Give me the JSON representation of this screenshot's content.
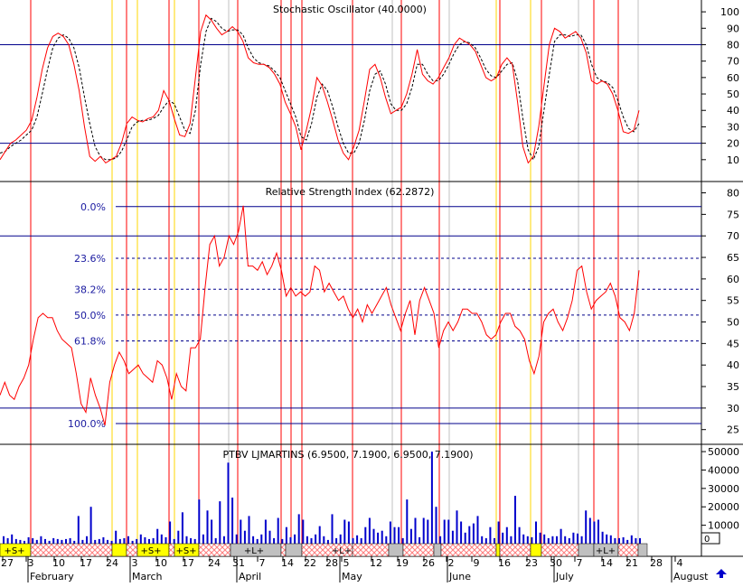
{
  "colors": {
    "background": "#ffffff",
    "kline": "#ff0000",
    "dline": "#000000",
    "level": "#00008b",
    "volume": "#0000cc",
    "vline_red": "#ff0000",
    "vline_yellow": "#ffd700",
    "vline_gray": "#c0c0c0",
    "fib_text": "#1a1aa0",
    "band_red": "#ff8080",
    "band_gray": "#c0c0c0",
    "band_yellow": "#ffff00",
    "arrow": "#0000cc"
  },
  "chart_data": [
    {
      "type": "line",
      "title": "Stochastic Oscillator (40.0000)",
      "ylim": [
        0,
        105
      ],
      "y_ticks": [
        10,
        20,
        30,
        40,
        50,
        60,
        70,
        80,
        90,
        100
      ],
      "levels": [
        80,
        20
      ],
      "x": [
        0,
        1,
        2,
        3,
        4,
        5,
        6,
        7,
        8,
        9,
        10,
        11,
        12,
        13,
        14,
        15,
        16,
        17,
        18,
        19,
        20,
        21,
        22,
        23,
        24,
        25,
        26,
        27,
        28,
        29,
        30,
        31,
        32,
        33,
        34,
        35,
        36,
        37,
        38,
        39,
        40,
        41,
        42,
        43,
        44,
        45,
        46,
        47,
        48,
        49,
        50,
        51,
        52,
        53,
        54,
        55,
        56,
        57,
        58,
        59,
        60,
        61,
        62,
        63,
        64,
        65,
        66,
        67,
        68,
        69,
        70,
        71,
        72,
        73,
        74,
        75,
        76,
        77,
        78,
        79,
        80,
        81,
        82,
        83,
        84,
        85,
        86,
        87,
        88,
        89,
        90,
        91,
        92,
        93,
        94,
        95,
        96,
        97,
        98,
        99,
        100,
        101,
        102,
        103,
        104,
        105,
        106,
        107,
        108,
        109,
        110,
        111,
        112,
        113,
        114,
        115,
        116,
        117,
        118,
        119,
        120,
        121,
        122,
        123,
        124,
        125,
        126,
        127,
        128,
        129,
        130,
        131,
        132,
        133,
        134,
        135,
        136,
        137,
        138,
        139,
        140,
        141,
        142,
        143,
        144,
        145,
        146,
        147,
        148,
        149,
        150,
        151,
        152,
        153,
        154,
        155,
        156,
        157,
        158,
        159,
        160,
        161,
        162,
        163,
        164,
        165,
        166,
        167,
        168,
        169,
        170,
        171,
        172,
        173,
        174,
        175,
        176,
        177,
        178,
        179,
        180,
        181
      ],
      "series": [
        {
          "values": [
            10,
            15,
            20,
            22,
            25,
            28,
            34,
            48,
            65,
            78,
            85,
            87,
            85,
            80,
            68,
            52,
            30,
            12,
            9,
            12,
            8,
            10,
            12,
            20,
            32,
            36,
            34,
            33,
            35,
            36,
            40,
            52,
            46,
            35,
            25,
            24,
            32,
            60,
            88,
            98,
            95,
            90,
            86,
            88,
            91,
            88,
            82,
            72,
            69,
            68,
            68,
            66,
            62,
            56,
            45,
            38,
            30,
            16,
            28,
            42,
            60,
            55,
            45,
            34,
            22,
            14,
            10,
            18,
            28,
            46,
            65,
            68,
            60,
            48,
            38,
            40,
            42,
            50,
            62,
            77,
            62,
            58,
            56,
            60,
            66,
            72,
            80,
            84,
            82,
            80,
            76,
            68,
            60,
            58,
            60,
            68,
            72,
            68,
            45,
            18,
            8,
            12,
            30,
            55,
            80,
            90,
            88,
            84,
            86,
            88,
            84,
            75,
            58,
            56,
            58,
            56,
            50,
            40,
            27,
            26,
            28,
            40
          ]
        },
        {
          "values": [
            14,
            15,
            18,
            20,
            22,
            25,
            28,
            36,
            50,
            65,
            78,
            84,
            86,
            84,
            78,
            66,
            48,
            32,
            18,
            12,
            10,
            10,
            11,
            15,
            22,
            30,
            33,
            34,
            34,
            35,
            37,
            42,
            46,
            44,
            36,
            28,
            26,
            40,
            68,
            88,
            96,
            94,
            90,
            88,
            89,
            89,
            86,
            78,
            72,
            69,
            68,
            67,
            64,
            60,
            52,
            44,
            36,
            24,
            22,
            32,
            48,
            56,
            52,
            42,
            30,
            20,
            14,
            14,
            20,
            34,
            52,
            62,
            64,
            56,
            44,
            40,
            40,
            44,
            54,
            68,
            68,
            62,
            58,
            58,
            62,
            68,
            75,
            80,
            82,
            81,
            78,
            72,
            65,
            61,
            60,
            64,
            68,
            69,
            58,
            35,
            16,
            10,
            18,
            40,
            62,
            82,
            86,
            86,
            85,
            86,
            86,
            80,
            68,
            60,
            58,
            57,
            54,
            46,
            36,
            29,
            27,
            32
          ]
        }
      ]
    },
    {
      "type": "line",
      "title": "Relative Strength Index (62.2872)",
      "ylim": [
        22,
        82
      ],
      "y_ticks": [
        25,
        30,
        35,
        40,
        45,
        50,
        55,
        60,
        65,
        70,
        75,
        80
      ],
      "levels": [
        70,
        30
      ],
      "fib_labels": [
        "0.0%",
        "23.6%",
        "38.2%",
        "50.0%",
        "61.8%",
        "100.0%"
      ],
      "fib_values": [
        76.8,
        64.8,
        57.6,
        51.6,
        45.6,
        26.4
      ],
      "series": [
        {
          "values": [
            33,
            36,
            33,
            32,
            35,
            37,
            40,
            46,
            51,
            52,
            51,
            51,
            48,
            46,
            45,
            44,
            38,
            31,
            29,
            37,
            33,
            30,
            26,
            36,
            40,
            43,
            41,
            38,
            39,
            40,
            38,
            37,
            36,
            41,
            40,
            37,
            32,
            38,
            35,
            34,
            44,
            44,
            46,
            58,
            68,
            70,
            63,
            65,
            70,
            68,
            71,
            77,
            63,
            63,
            62,
            64,
            61,
            63,
            66,
            62,
            56,
            58,
            56,
            57,
            56,
            57,
            63,
            62,
            57,
            59,
            57,
            55,
            56,
            53,
            51,
            53,
            50,
            54,
            52,
            54,
            56,
            58,
            54,
            51,
            48,
            52,
            55,
            47,
            55,
            58,
            55,
            52,
            44,
            48,
            50,
            48,
            50,
            53,
            53,
            52,
            52,
            50,
            47,
            46,
            47,
            50,
            52,
            52,
            49,
            48,
            46,
            41,
            38,
            42,
            50,
            52,
            53,
            50,
            48,
            51,
            55,
            62,
            63,
            57,
            53,
            55,
            56,
            57,
            59,
            56,
            51,
            50,
            48,
            52,
            62
          ]
        }
      ]
    },
    {
      "type": "bar",
      "title": "PTBV LJMARTINS (6.9500, 7.1900, 6.9500, 7.1900)",
      "ylim": [
        0,
        52000
      ],
      "y_ticks": [
        10000,
        20000,
        30000,
        40000,
        50000
      ],
      "y_tick_labels": [
        "10000",
        "20000",
        "30000",
        "40000",
        "50000"
      ],
      "values": [
        4000,
        3000,
        5000,
        2500,
        2000,
        1500,
        3500,
        3000,
        2000,
        4000,
        2500,
        1500,
        3000,
        2500,
        2000,
        2500,
        3000,
        1500,
        15000,
        2000,
        4000,
        20000,
        2000,
        2500,
        3500,
        2000,
        1500,
        7000,
        2500,
        3000,
        4000,
        1500,
        2500,
        5000,
        3500,
        2500,
        3000,
        8000,
        5000,
        3500,
        12000,
        2500,
        7000,
        17000,
        4000,
        3000,
        2500,
        24000,
        5000,
        18000,
        13000,
        3000,
        23000,
        4000,
        44000,
        25000,
        5000,
        13000,
        7000,
        15000,
        4000,
        2500,
        5000,
        13000,
        7000,
        3000,
        14000,
        2500,
        9000,
        3500,
        5000,
        16000,
        13000,
        4000,
        3000,
        5000,
        9500,
        4000,
        2000,
        16000,
        3000,
        5000,
        13000,
        12000,
        3000,
        4500,
        3000,
        9000,
        14000,
        8000,
        6000,
        7000,
        4000,
        12000,
        9000,
        9000,
        3000,
        24000,
        8000,
        14000,
        3500,
        14000,
        13000,
        50000,
        20000,
        4000,
        13000,
        13000,
        7000,
        18000,
        12000,
        6000,
        9500,
        11000,
        15000,
        4000,
        3000,
        9000,
        3000,
        12000,
        6000,
        9000,
        4000,
        26000,
        9000,
        5000,
        4000,
        3500,
        12000,
        6000,
        5000,
        3000,
        4000,
        4000,
        8000,
        4000,
        3000,
        6000,
        5500,
        4000,
        18000,
        14000,
        12000,
        13000,
        6500,
        5000,
        4500,
        3000,
        3000,
        3500,
        2000,
        4500,
        3000,
        3000
      ]
    }
  ],
  "date_axis": {
    "day_labels": [
      "27",
      "3",
      "10",
      "17",
      "24",
      "3",
      "10",
      "17",
      "24",
      "31",
      "7",
      "14",
      "22",
      "28",
      "5",
      "12",
      "19",
      "26",
      "2",
      "9",
      "16",
      "23",
      "30",
      "7",
      "14",
      "21",
      "28",
      "4"
    ],
    "month_labels": [
      "February",
      "March",
      "April",
      "May",
      "June",
      "July",
      "August"
    ],
    "scroll_box": "0"
  },
  "signal_band": {
    "labels": [
      "+S+",
      "+S+",
      "+S+",
      "+L+",
      "+L+",
      "+L+"
    ]
  },
  "icons": {
    "scroll_arrow": "up-arrow-icon"
  }
}
